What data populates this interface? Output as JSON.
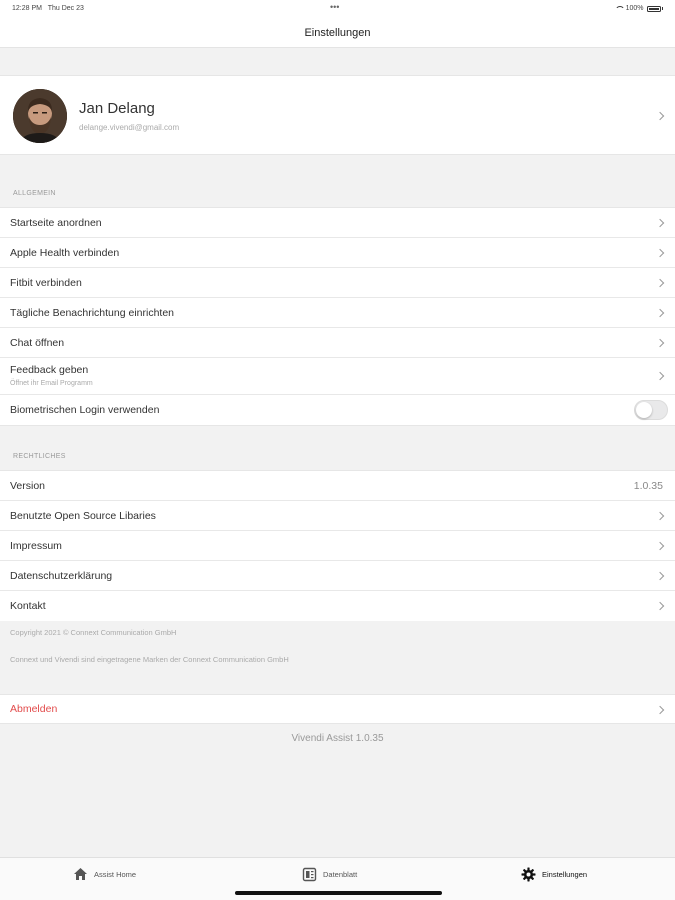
{
  "status_bar": {
    "time": "12:28 PM",
    "date": "Thu Dec 23",
    "dots": "•••",
    "battery": "100%"
  },
  "nav": {
    "title": "Einstellungen"
  },
  "profile": {
    "name": "Jan Delang",
    "email": "delange.vivendi@gmail.com"
  },
  "general": {
    "header": "ALLGEMEIN",
    "items": [
      {
        "label": "Startseite anordnen"
      },
      {
        "label": "Apple Health verbinden"
      },
      {
        "label": "Fitbit verbinden"
      },
      {
        "label": "Tägliche Benachrichtung einrichten"
      },
      {
        "label": "Chat öffnen"
      },
      {
        "label": "Feedback geben",
        "sublabel": "Öffnet ihr Email Programm"
      },
      {
        "label": "Biometrischen Login verwenden",
        "toggle_on": false
      }
    ]
  },
  "legal": {
    "header": "RECHTLICHES",
    "items": [
      {
        "label": "Version",
        "value": "1.0.35"
      },
      {
        "label": "Benutzte Open Source Libaries"
      },
      {
        "label": "Impressum"
      },
      {
        "label": "Datenschutzerklärung"
      },
      {
        "label": "Kontakt"
      }
    ]
  },
  "footer": {
    "copyright": "Copyright 2021 © Connext Communication GmbH",
    "trademark": "Connext und Vivendi sind eingetragene Marken der Connext Communication GmbH"
  },
  "logout": {
    "label": "Abmelden",
    "color": "#e24b4b"
  },
  "app_version": "Vivendi Assist 1.0.35",
  "tabs": [
    {
      "label": "Assist Home",
      "icon": "home-icon"
    },
    {
      "label": "Datenblatt",
      "icon": "document-icon"
    },
    {
      "label": "Einstellungen",
      "icon": "gear-icon",
      "selected": true
    }
  ]
}
